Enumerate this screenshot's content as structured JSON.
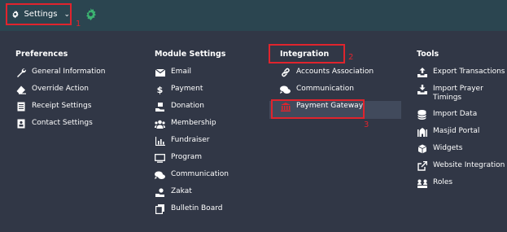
{
  "topbar": {
    "settings_label": "Settings",
    "chevron": "⌄"
  },
  "callouts": [
    "1",
    "2",
    "3"
  ],
  "columns": [
    {
      "heading": "Preferences",
      "items": [
        {
          "label": "General Information",
          "icon": "wrench-icon"
        },
        {
          "label": "Override Action",
          "icon": "eraser-icon"
        },
        {
          "label": "Receipt Settings",
          "icon": "receipt-icon"
        },
        {
          "label": "Contact Settings",
          "icon": "contact-book-icon"
        }
      ]
    },
    {
      "heading": "Module Settings",
      "items": [
        {
          "label": "Email",
          "icon": "envelope-icon"
        },
        {
          "label": "Payment",
          "icon": "dollar-icon"
        },
        {
          "label": "Donation",
          "icon": "donation-icon"
        },
        {
          "label": "Membership",
          "icon": "users-icon"
        },
        {
          "label": "Fundraiser",
          "icon": "bar-chart-icon"
        },
        {
          "label": "Program",
          "icon": "monitor-icon"
        },
        {
          "label": "Communication",
          "icon": "chat-icon"
        },
        {
          "label": "Zakat",
          "icon": "hand-coin-icon"
        },
        {
          "label": "Bulletin Board",
          "icon": "copy-icon"
        }
      ]
    },
    {
      "heading": "Integration",
      "items": [
        {
          "label": "Accounts Association",
          "icon": "link-icon"
        },
        {
          "label": "Communication",
          "icon": "chat-icon"
        },
        {
          "label": "Payment Gateway",
          "icon": "bank-icon"
        }
      ]
    },
    {
      "heading": "Tools",
      "items": [
        {
          "label": "Export Transactions",
          "icon": "export-icon"
        },
        {
          "label": "Import Prayer Timings",
          "icon": "import-icon"
        },
        {
          "label": "Import Data",
          "icon": "database-icon"
        },
        {
          "label": "Masjid Portal",
          "icon": "mosque-icon"
        },
        {
          "label": "Widgets",
          "icon": "cube-icon"
        },
        {
          "label": "Website Integration",
          "icon": "external-link-icon"
        },
        {
          "label": "Roles",
          "icon": "roles-icon"
        }
      ]
    }
  ],
  "colors": {
    "background": "#313746",
    "topbar": "#2b4550",
    "highlight": "#e0242d",
    "accent_green": "#3cb371",
    "payment_gateway_icon": "#e0242d",
    "hover_row": "#414a5c"
  }
}
